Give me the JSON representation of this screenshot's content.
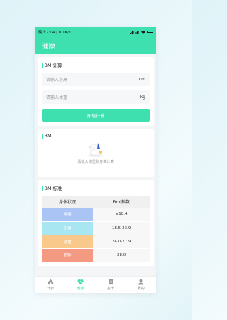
{
  "statusbar": {
    "time": "晚上7:04 | 0.1K/s",
    "battery": "37"
  },
  "header": {
    "title": "健康"
  },
  "calc": {
    "title": "BMI计算",
    "height_placeholder": "请输入身高",
    "height_unit": "cm",
    "weight_placeholder": "请输入体重",
    "weight_unit": "kg",
    "button_label": "开始计算"
  },
  "result": {
    "title": "BMI",
    "empty_tip": "请输入体重和身高计算"
  },
  "standard": {
    "title": "BMI标准",
    "headers": [
      "身体状况",
      "Bmi指数"
    ],
    "rows": [
      {
        "level": "偏瘦",
        "range": "≤18.4",
        "color": "#a9c4f5"
      },
      {
        "level": "正常",
        "range": "18.5-23.9",
        "color": "#a8e6f2"
      },
      {
        "level": "过重",
        "range": "24.0-27.9",
        "color": "#f8c98a"
      },
      {
        "level": "肥胖",
        "range": "28.0",
        "color": "#f49a82"
      }
    ]
  },
  "tabs": [
    {
      "label": "计步",
      "icon": "home-icon",
      "active": false
    },
    {
      "label": "健康",
      "icon": "heart-icon",
      "active": true
    },
    {
      "label": "打卡",
      "icon": "checkin-icon",
      "active": false
    },
    {
      "label": "我的",
      "icon": "user-icon",
      "active": false
    }
  ],
  "colors": {
    "accent": "#3fe0b0"
  }
}
